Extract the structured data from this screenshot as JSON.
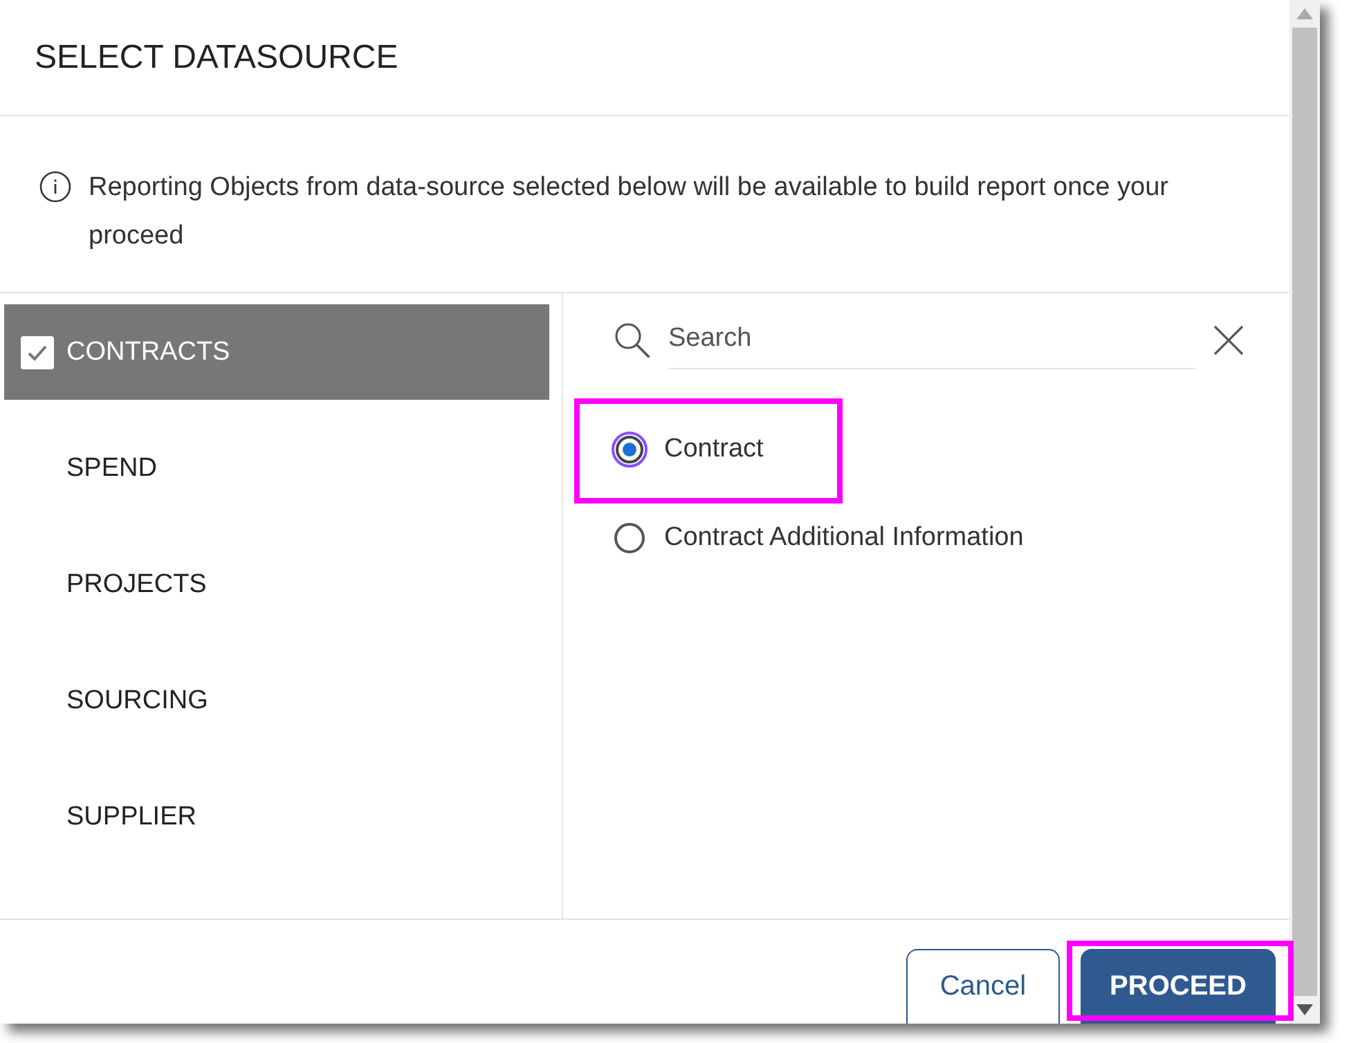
{
  "dialog": {
    "title": "SELECT DATASOURCE",
    "info": "Reporting Objects from data-source selected below will be available to build report once your proceed"
  },
  "sources": [
    {
      "label": "CONTRACTS",
      "selected": true
    },
    {
      "label": "SPEND",
      "selected": false
    },
    {
      "label": "PROJECTS",
      "selected": false
    },
    {
      "label": "SOURCING",
      "selected": false
    },
    {
      "label": "SUPPLIER",
      "selected": false
    }
  ],
  "search": {
    "placeholder": "Search"
  },
  "objects": [
    {
      "label": "Contract",
      "selected": true,
      "highlighted": true
    },
    {
      "label": "Contract Additional Information",
      "selected": false,
      "highlighted": false
    }
  ],
  "buttons": [
    {
      "label": "Cancel",
      "kind": "secondary",
      "highlighted": false
    },
    {
      "label": "PROCEED",
      "kind": "primary",
      "highlighted": true
    }
  ]
}
